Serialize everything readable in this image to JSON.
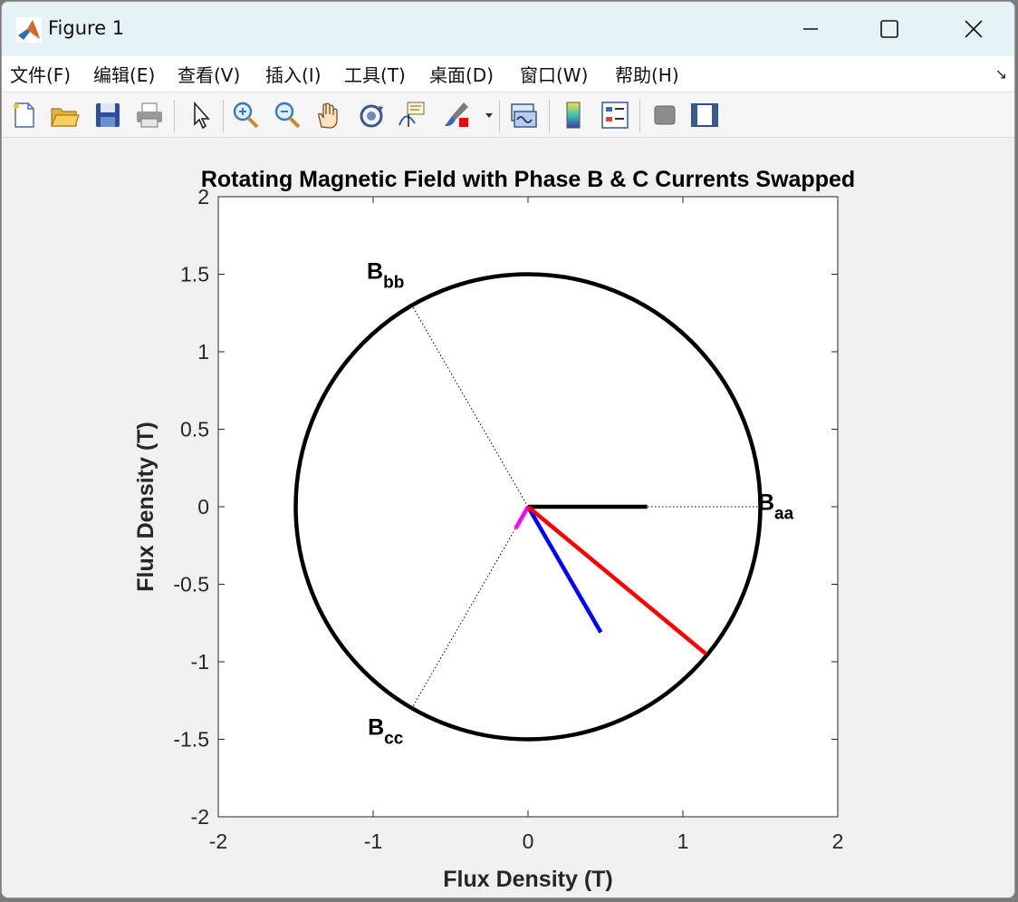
{
  "window": {
    "title": "Figure 1"
  },
  "menu": [
    {
      "label": "文件(F)"
    },
    {
      "label": "编辑(E)"
    },
    {
      "label": "查看(V)"
    },
    {
      "label": "插入(I)"
    },
    {
      "label": "工具(T)"
    },
    {
      "label": "桌面(D)"
    },
    {
      "label": "窗口(W)"
    },
    {
      "label": "帮助(H)"
    }
  ],
  "toolbar": {
    "icons": [
      "new-figure-icon",
      "open-file-icon",
      "save-icon",
      "print-icon",
      "edit-plot-arrow-icon",
      "zoom-in-icon",
      "zoom-out-icon",
      "pan-hand-icon",
      "rotate-3d-icon",
      "data-cursor-icon",
      "brush-icon",
      "link-plot-icon",
      "colorbar-icon",
      "legend-icon",
      "hide-plot-tools-icon",
      "show-plot-tools-icon"
    ]
  },
  "colors": {
    "net_field": "#ff0000",
    "phase_a": "#000000",
    "phase_b": "#0000ff",
    "phase_c": "#ff00ff",
    "circle": "#000000"
  },
  "chart_data": {
    "type": "line",
    "title": "Rotating Magnetic Field with Phase B & C Currents Swapped",
    "xlabel": "Flux Density (T)",
    "ylabel": "Flux Density (T)",
    "xlim": [
      -2,
      2
    ],
    "ylim": [
      -2,
      2
    ],
    "xticks": [
      "-2",
      "-1",
      "0",
      "1",
      "2"
    ],
    "yticks": [
      "2",
      "1.5",
      "1",
      "0.5",
      "0",
      "-0.5",
      "-1",
      "-1.5",
      "-2"
    ],
    "grid": false,
    "circle": {
      "center": [
        0,
        0
      ],
      "radius": 1.5
    },
    "axis_labels": [
      {
        "main": "B",
        "sub": "aa",
        "x": 1.6,
        "y": -0.02
      },
      {
        "main": "B",
        "sub": "bb",
        "x": -0.92,
        "y": 1.47
      },
      {
        "main": "B",
        "sub": "cc",
        "x": -0.92,
        "y": -1.47
      }
    ],
    "reference_lines": [
      {
        "name": "aa-axis",
        "from": [
          0,
          0
        ],
        "to": [
          1.5,
          0
        ]
      },
      {
        "name": "bb-axis",
        "from": [
          0,
          0
        ],
        "to": [
          -0.75,
          1.3
        ]
      },
      {
        "name": "cc-axis",
        "from": [
          0,
          0
        ],
        "to": [
          -0.75,
          -1.3
        ]
      }
    ],
    "vectors": [
      {
        "name": "phase-a",
        "color": "#000000",
        "to": [
          0.77,
          0
        ]
      },
      {
        "name": "phase-b",
        "color": "#0000ff",
        "to": [
          0.47,
          -0.81
        ]
      },
      {
        "name": "phase-c",
        "color": "#ff00ff",
        "to": [
          -0.08,
          -0.14
        ]
      },
      {
        "name": "net",
        "color": "#ff0000",
        "to": [
          1.15,
          -0.95
        ]
      }
    ]
  }
}
